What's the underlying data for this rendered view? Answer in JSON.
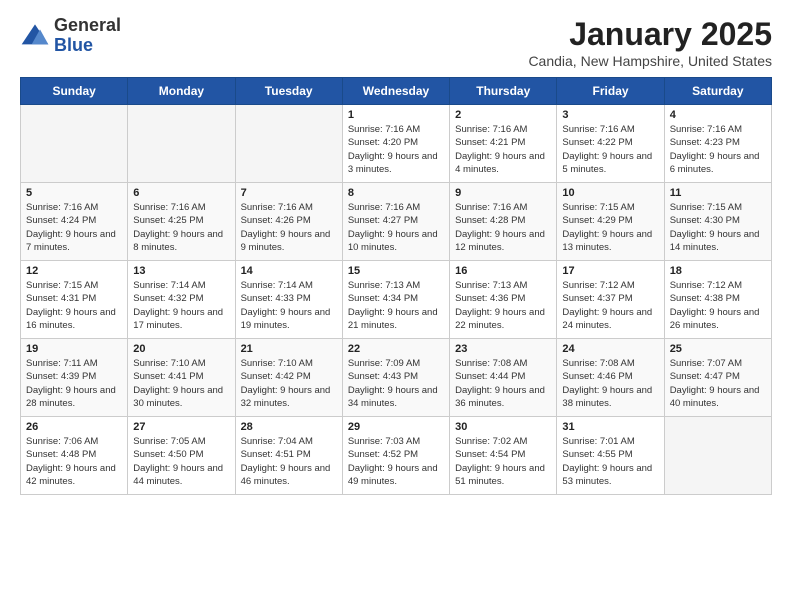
{
  "logo": {
    "general": "General",
    "blue": "Blue"
  },
  "header": {
    "month": "January 2025",
    "location": "Candia, New Hampshire, United States"
  },
  "weekdays": [
    "Sunday",
    "Monday",
    "Tuesday",
    "Wednesday",
    "Thursday",
    "Friday",
    "Saturday"
  ],
  "weeks": [
    [
      {
        "day": "",
        "info": ""
      },
      {
        "day": "",
        "info": ""
      },
      {
        "day": "",
        "info": ""
      },
      {
        "day": "1",
        "info": "Sunrise: 7:16 AM\nSunset: 4:20 PM\nDaylight: 9 hours and 3 minutes."
      },
      {
        "day": "2",
        "info": "Sunrise: 7:16 AM\nSunset: 4:21 PM\nDaylight: 9 hours and 4 minutes."
      },
      {
        "day": "3",
        "info": "Sunrise: 7:16 AM\nSunset: 4:22 PM\nDaylight: 9 hours and 5 minutes."
      },
      {
        "day": "4",
        "info": "Sunrise: 7:16 AM\nSunset: 4:23 PM\nDaylight: 9 hours and 6 minutes."
      }
    ],
    [
      {
        "day": "5",
        "info": "Sunrise: 7:16 AM\nSunset: 4:24 PM\nDaylight: 9 hours and 7 minutes."
      },
      {
        "day": "6",
        "info": "Sunrise: 7:16 AM\nSunset: 4:25 PM\nDaylight: 9 hours and 8 minutes."
      },
      {
        "day": "7",
        "info": "Sunrise: 7:16 AM\nSunset: 4:26 PM\nDaylight: 9 hours and 9 minutes."
      },
      {
        "day": "8",
        "info": "Sunrise: 7:16 AM\nSunset: 4:27 PM\nDaylight: 9 hours and 10 minutes."
      },
      {
        "day": "9",
        "info": "Sunrise: 7:16 AM\nSunset: 4:28 PM\nDaylight: 9 hours and 12 minutes."
      },
      {
        "day": "10",
        "info": "Sunrise: 7:15 AM\nSunset: 4:29 PM\nDaylight: 9 hours and 13 minutes."
      },
      {
        "day": "11",
        "info": "Sunrise: 7:15 AM\nSunset: 4:30 PM\nDaylight: 9 hours and 14 minutes."
      }
    ],
    [
      {
        "day": "12",
        "info": "Sunrise: 7:15 AM\nSunset: 4:31 PM\nDaylight: 9 hours and 16 minutes."
      },
      {
        "day": "13",
        "info": "Sunrise: 7:14 AM\nSunset: 4:32 PM\nDaylight: 9 hours and 17 minutes."
      },
      {
        "day": "14",
        "info": "Sunrise: 7:14 AM\nSunset: 4:33 PM\nDaylight: 9 hours and 19 minutes."
      },
      {
        "day": "15",
        "info": "Sunrise: 7:13 AM\nSunset: 4:34 PM\nDaylight: 9 hours and 21 minutes."
      },
      {
        "day": "16",
        "info": "Sunrise: 7:13 AM\nSunset: 4:36 PM\nDaylight: 9 hours and 22 minutes."
      },
      {
        "day": "17",
        "info": "Sunrise: 7:12 AM\nSunset: 4:37 PM\nDaylight: 9 hours and 24 minutes."
      },
      {
        "day": "18",
        "info": "Sunrise: 7:12 AM\nSunset: 4:38 PM\nDaylight: 9 hours and 26 minutes."
      }
    ],
    [
      {
        "day": "19",
        "info": "Sunrise: 7:11 AM\nSunset: 4:39 PM\nDaylight: 9 hours and 28 minutes."
      },
      {
        "day": "20",
        "info": "Sunrise: 7:10 AM\nSunset: 4:41 PM\nDaylight: 9 hours and 30 minutes."
      },
      {
        "day": "21",
        "info": "Sunrise: 7:10 AM\nSunset: 4:42 PM\nDaylight: 9 hours and 32 minutes."
      },
      {
        "day": "22",
        "info": "Sunrise: 7:09 AM\nSunset: 4:43 PM\nDaylight: 9 hours and 34 minutes."
      },
      {
        "day": "23",
        "info": "Sunrise: 7:08 AM\nSunset: 4:44 PM\nDaylight: 9 hours and 36 minutes."
      },
      {
        "day": "24",
        "info": "Sunrise: 7:08 AM\nSunset: 4:46 PM\nDaylight: 9 hours and 38 minutes."
      },
      {
        "day": "25",
        "info": "Sunrise: 7:07 AM\nSunset: 4:47 PM\nDaylight: 9 hours and 40 minutes."
      }
    ],
    [
      {
        "day": "26",
        "info": "Sunrise: 7:06 AM\nSunset: 4:48 PM\nDaylight: 9 hours and 42 minutes."
      },
      {
        "day": "27",
        "info": "Sunrise: 7:05 AM\nSunset: 4:50 PM\nDaylight: 9 hours and 44 minutes."
      },
      {
        "day": "28",
        "info": "Sunrise: 7:04 AM\nSunset: 4:51 PM\nDaylight: 9 hours and 46 minutes."
      },
      {
        "day": "29",
        "info": "Sunrise: 7:03 AM\nSunset: 4:52 PM\nDaylight: 9 hours and 49 minutes."
      },
      {
        "day": "30",
        "info": "Sunrise: 7:02 AM\nSunset: 4:54 PM\nDaylight: 9 hours and 51 minutes."
      },
      {
        "day": "31",
        "info": "Sunrise: 7:01 AM\nSunset: 4:55 PM\nDaylight: 9 hours and 53 minutes."
      },
      {
        "day": "",
        "info": ""
      }
    ]
  ]
}
